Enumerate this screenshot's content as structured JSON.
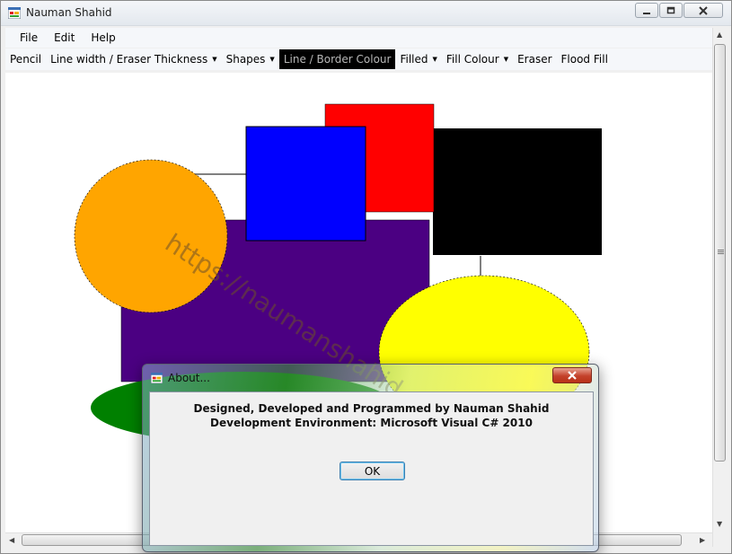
{
  "window": {
    "title": "Nauman Shahid",
    "controls": [
      "minimize-icon",
      "maximize-icon",
      "close-icon"
    ]
  },
  "menu": {
    "items": [
      {
        "label": "File"
      },
      {
        "label": "Edit"
      },
      {
        "label": "Help"
      }
    ]
  },
  "toolbar": {
    "items": [
      {
        "label": "Pencil",
        "dropdown": false
      },
      {
        "label": "Line width / Eraser Thickness",
        "dropdown": true
      },
      {
        "label": "Shapes",
        "dropdown": true
      },
      {
        "label": "Line / Border Colour",
        "dropdown": false,
        "selected": true
      },
      {
        "label": "Filled",
        "dropdown": true
      },
      {
        "label": "Fill Colour",
        "dropdown": true
      },
      {
        "label": "Eraser",
        "dropdown": false
      },
      {
        "label": "Flood Fill",
        "dropdown": false
      }
    ]
  },
  "canvas": {
    "shape_colors": {
      "orange_circle": "#FFA500",
      "purple_rectangle": "#4B0082",
      "blue_square": "#0000FF",
      "red_square": "#FF0000",
      "black_rectangle": "#000000",
      "yellow_circle": "#FFFF00",
      "green_ellipse": "#008000"
    },
    "watermark": "https://naumanshahid.github.com/"
  },
  "dialog": {
    "title": "About...",
    "line1": "Designed, Developed and Programmed by Nauman Shahid",
    "line2": "Development Environment: Microsoft Visual C# 2010",
    "ok_label": "OK"
  }
}
